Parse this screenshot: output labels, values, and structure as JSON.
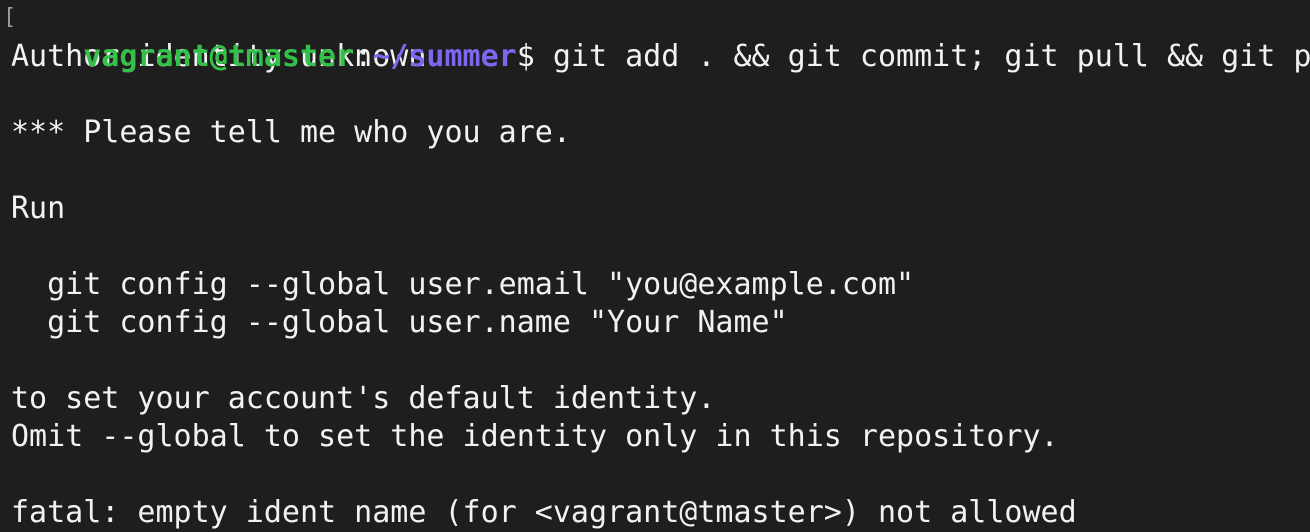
{
  "prompt": {
    "user_host": "vagrant@tmaster",
    "colon": ":",
    "path": "~/summer",
    "symbol": "$",
    "command": " git add . && git commit; git pull && git push"
  },
  "output": {
    "line1": "Author identity unknown",
    "line2": "",
    "line3": "*** Please tell me who you are.",
    "line4": "",
    "line5": "Run",
    "line6": "",
    "line7": "  git config --global user.email \"you@example.com\"",
    "line8": "  git config --global user.name \"Your Name\"",
    "line9": "",
    "line10": "to set your account's default identity.",
    "line11": "Omit --global to set the identity only in this repository.",
    "line12": "",
    "line13": "fatal: empty ident name (for <vagrant@tmaster>) not allowed"
  },
  "colors": {
    "background": "#1e1e1e",
    "foreground": "#f2f2f2",
    "user_host": "#35c04a",
    "path": "#7b68ee"
  }
}
